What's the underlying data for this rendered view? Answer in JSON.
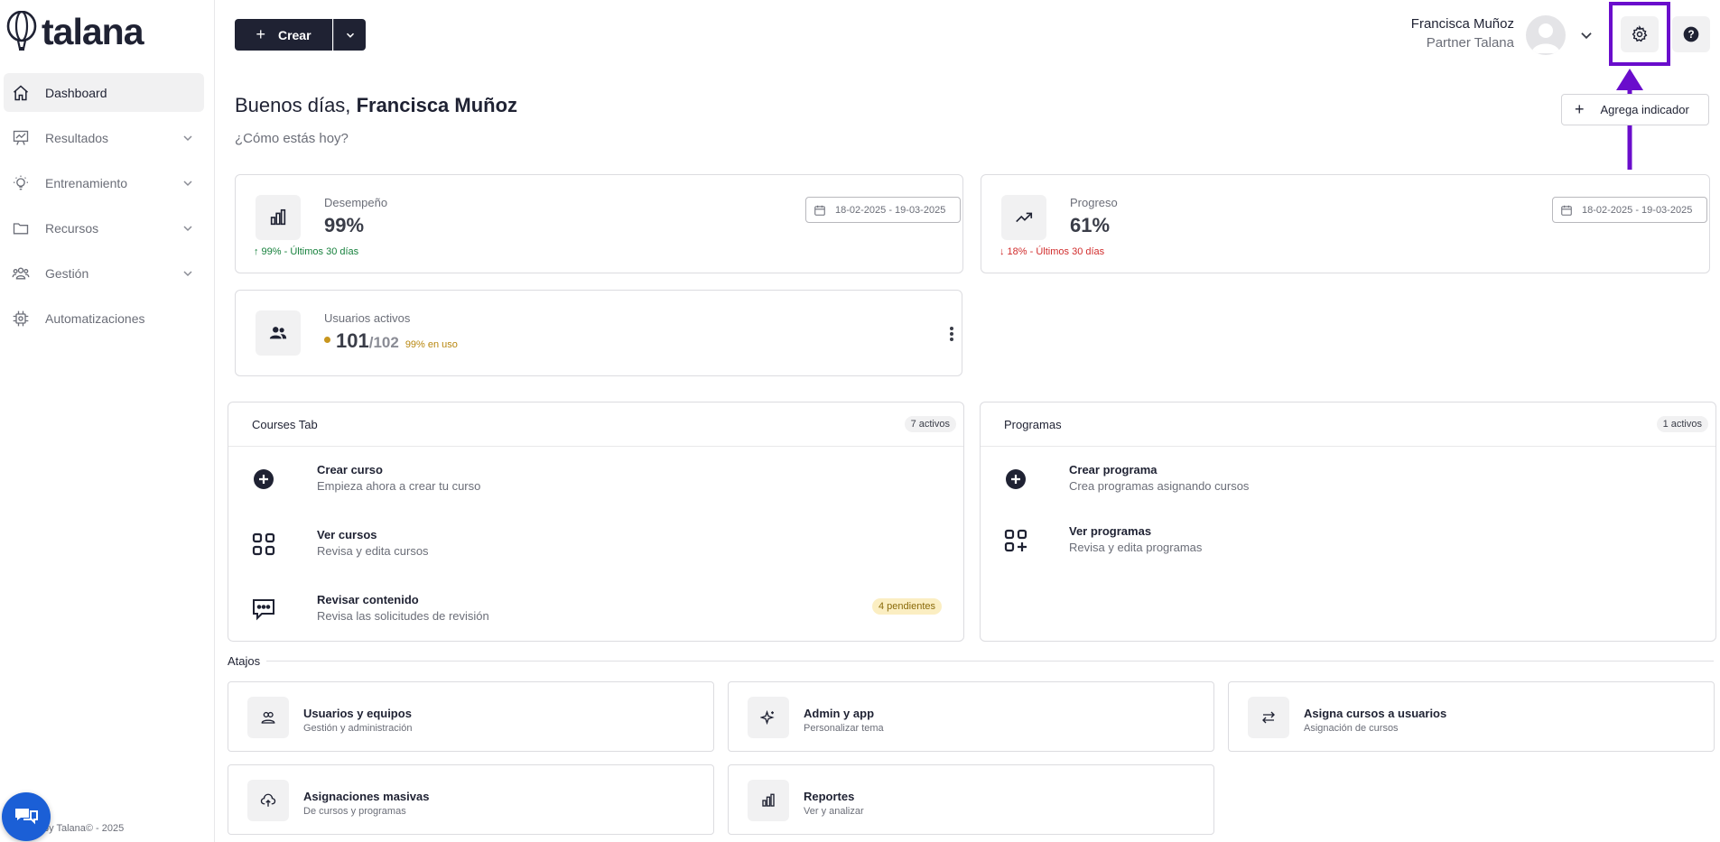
{
  "brand": {
    "name": "talana"
  },
  "sidebar": {
    "items": [
      {
        "label": "Dashboard",
        "icon": "home-icon",
        "active": true,
        "has_chevron": false
      },
      {
        "label": "Resultados",
        "icon": "chart-board-icon",
        "active": false,
        "has_chevron": true
      },
      {
        "label": "Entrenamiento",
        "icon": "lightbulb-icon",
        "active": false,
        "has_chevron": true
      },
      {
        "label": "Recursos",
        "icon": "folder-icon",
        "active": false,
        "has_chevron": true
      },
      {
        "label": "Gestión",
        "icon": "users-group-icon",
        "active": false,
        "has_chevron": true
      },
      {
        "label": "Automatizaciones",
        "icon": "cpu-icon",
        "active": false,
        "has_chevron": false
      }
    ],
    "footer": "by Talana© - 2025"
  },
  "topbar": {
    "crear_label": "Crear",
    "user_name": "Francisca Muñoz",
    "user_role": "Partner Talana"
  },
  "greeting": {
    "prefix": "Buenos días,",
    "name": "Francisca Muñoz",
    "subtitle": "¿Cómo estás hoy?",
    "add_indicator": "Agrega indicador"
  },
  "stats": {
    "desempeno": {
      "label": "Desempeño",
      "value": "99%",
      "trend": "↑ 99% - Últimos 30 días",
      "date_range": "18-02-2025 - 19-03-2025"
    },
    "progreso": {
      "label": "Progreso",
      "value": "61%",
      "trend": "↓ 18% - Últimos 30 días",
      "date_range": "18-02-2025 - 19-03-2025"
    },
    "usuarios": {
      "label": "Usuarios activos",
      "active": "101",
      "total": "/102",
      "usage": "99% en uso"
    }
  },
  "courses_panel": {
    "title": "Courses Tab",
    "badge": "7 activos",
    "items": [
      {
        "title": "Crear curso",
        "subtitle": "Empieza ahora a crear tu curso",
        "icon": "plus-circle-icon"
      },
      {
        "title": "Ver cursos",
        "subtitle": "Revisa y edita cursos",
        "icon": "grid-icon"
      },
      {
        "title": "Revisar contenido",
        "subtitle": "Revisa las solicitudes de revisión",
        "icon": "message-dots-icon",
        "badge": "4 pendientes"
      }
    ]
  },
  "programs_panel": {
    "title": "Programas",
    "badge": "1 activos",
    "items": [
      {
        "title": "Crear programa",
        "subtitle": "Crea programas asignando cursos",
        "icon": "plus-circle-icon"
      },
      {
        "title": "Ver programas",
        "subtitle": "Revisa y edita programas",
        "icon": "grid-plus-icon"
      }
    ]
  },
  "atajos": {
    "label": "Atajos",
    "items": [
      {
        "title": "Usuarios y equipos",
        "subtitle": "Gestión y administración",
        "icon": "users-icon"
      },
      {
        "title": "Admin y app",
        "subtitle": "Personalizar tema",
        "icon": "sparkle-icon"
      },
      {
        "title": "Asigna cursos a usuarios",
        "subtitle": "Asignación de cursos",
        "icon": "swap-arrows-icon"
      },
      {
        "title": "Asignaciones masivas",
        "subtitle": "De cursos y programas",
        "icon": "cloud-upload-icon"
      },
      {
        "title": "Reportes",
        "subtitle": "Ver y analizar",
        "icon": "bar-chart-icon"
      }
    ]
  },
  "colors": {
    "dark": "#1f2233",
    "highlight": "#6a0dcc",
    "trend_up": "#16803c",
    "trend_down": "#d12c2c",
    "chat": "#1b5fd6"
  }
}
